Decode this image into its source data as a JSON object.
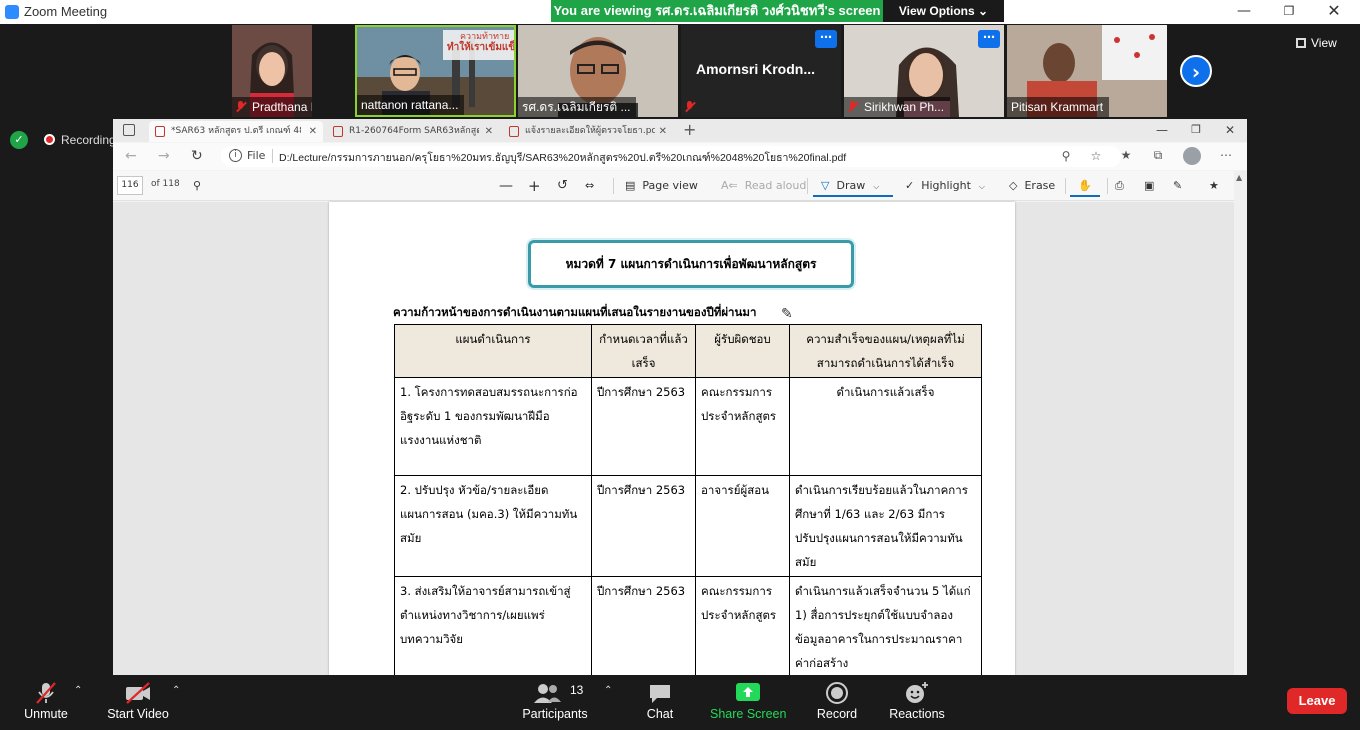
{
  "zoom": {
    "window_title": "Zoom Meeting",
    "banner_text": "You are viewing รศ.ดร.เฉลิมเกียรติ วงศ์วนิชทวี's screen",
    "view_options_label": "View Options",
    "view_label": "View",
    "recording_label": "Recording",
    "tiles": [
      {
        "name": "Pradthana M...",
        "muted": true
      },
      {
        "name": "nattanon rattana...",
        "muted": false,
        "bg_text_1": "ความท้าทาย",
        "bg_text_2": "ทำให้เราเข้มแข็ง"
      },
      {
        "name": "รศ.ดร.เฉลิมเกียรติ ...",
        "muted": false
      },
      {
        "name": "Amornsri  Krodn...",
        "muted": true
      },
      {
        "name": "Sirikhwan Ph...",
        "muted": true
      },
      {
        "name": "Pitisan Krammart",
        "muted": false
      }
    ],
    "controls": {
      "unmute": "Unmute",
      "start_video": "Start Video",
      "participants": "Participants",
      "participants_count": "13",
      "chat": "Chat",
      "share_screen": "Share Screen",
      "record": "Record",
      "reactions": "Reactions",
      "leave": "Leave"
    }
  },
  "edge": {
    "tabs": [
      {
        "title": "*SAR63 หลักสูตร ป.ตรี เกณฑ์ 48 โยธา"
      },
      {
        "title": "R1-260764Form SAR63หลักสูตร ป.ตรี"
      },
      {
        "title": "แจ้งรายละเอียดให้ผู้ตรวจโยธา.pdf"
      }
    ],
    "address": {
      "scheme_label": "File",
      "url": "D:/Lecture/กรรมการภายนอก/ครุโยธา%20มทร.ธัญบุรี/SAR63%20หลักสูตร%20ป.ตรี%20เกณฑ์%2048%20โยธา%20final.pdf"
    },
    "pdf_toolbar": {
      "page_current": "116",
      "page_total": "of 118",
      "page_view": "Page view",
      "read_aloud": "Read aloud",
      "draw": "Draw",
      "highlight": "Highlight",
      "erase": "Erase"
    }
  },
  "document": {
    "section_title": "หมวดที่ 7 แผนการดำเนินการเพื่อพัฒนาหลักสูตร",
    "heading": "ความก้าวหน้าของการดำเนินงานตามแผนที่เสนอในรายงานของปีที่ผ่านมา",
    "table": {
      "headers": [
        "แผนดำเนินการ",
        "กำหนดเวลาที่แล้วเสร็จ",
        "ผู้รับผิดชอบ",
        "ความสำเร็จของแผน/เหตุผลที่ไม่สามารถดำเนินการได้สำเร็จ"
      ],
      "rows": [
        {
          "plan": "1. โครงการทดสอบสมรรถนะการก่ออิฐระดับ 1 ของกรมพัฒนาฝีมือแรงงานแห่งชาติ",
          "deadline": "ปีการศึกษา 2563",
          "owner": "คณะกรรมการประจำหลักสูตร",
          "result": "ดำเนินการแล้วเสร็จ"
        },
        {
          "plan": "2.  ปรับปรุง หัวข้อ/รายละเอียดแผนการสอน (มคอ.3) ให้มีความทันสมัย",
          "deadline": "ปีการศึกษา 2563",
          "owner": "อาจารย์ผู้สอน",
          "result": "ดำเนินการเรียบร้อยแล้วในภาคการศึกษาที่ 1/63 และ 2/63 มีการปรับปรุงแผนการสอนให้มีความทันสมัย"
        },
        {
          "plan": "3. ส่งเสริมให้อาจารย์สามารถเข้าสู่ตำแหน่งทางวิชาการ/เผยแพร่บทความวิจัย",
          "deadline": "ปีการศึกษา 2563",
          "owner": "คณะกรรมการประจำหลักสูตร",
          "result": "ดำเนินการแล้วเสร็จจำนวน 5  ได้แก่ 1) สื่อการประยุกต์ใช้แบบจำลองข้อมูลอาคารในการประมาณราคาค่าก่อสร้าง"
        }
      ]
    }
  }
}
